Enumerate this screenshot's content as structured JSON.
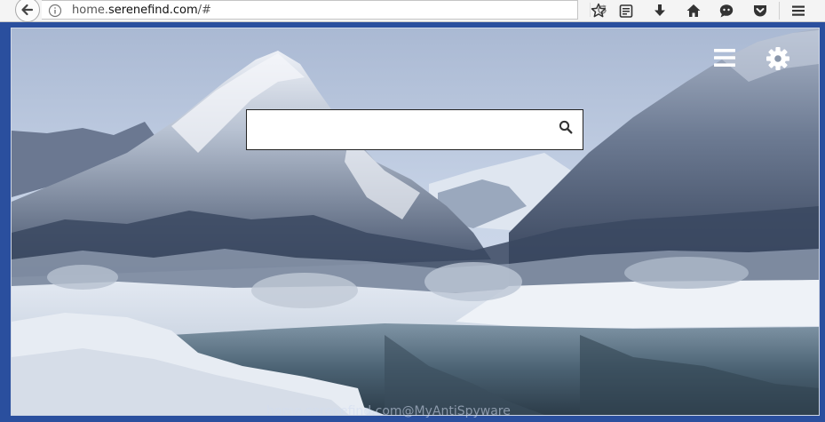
{
  "browser": {
    "url_host_prefix": "home.",
    "url_host_domain": "serenefind.com",
    "url_path": "/#",
    "toolbar_icons": [
      "back-arrow-icon",
      "info-icon",
      "reload-icon",
      "bookmark-star-icon",
      "reading-list-icon",
      "download-icon",
      "home-icon",
      "chat-icon",
      "pocket-icon",
      "hamburger-menu-icon"
    ]
  },
  "page": {
    "search": {
      "placeholder": "",
      "value": ""
    },
    "top_icons": [
      "menu-icon",
      "gear-icon"
    ]
  },
  "watermark": "home.serenefind.com@MyAntiSpyware",
  "colors": {
    "frame_bg": "#2a4f9e",
    "toolbar_bg": "#f4f4f4",
    "sky": "#c9d7ea",
    "snow": "#eef2f8",
    "water": "#5f7f96"
  }
}
